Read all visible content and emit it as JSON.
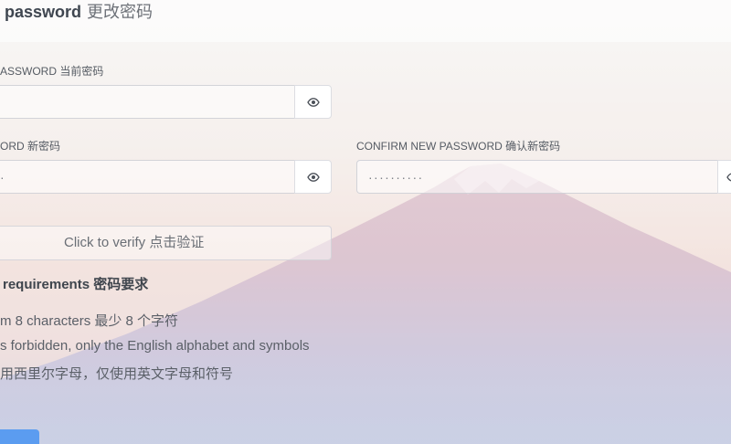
{
  "header": {
    "title_en": "password",
    "title_zh": "更改密码"
  },
  "form": {
    "current_password": {
      "label": "ASSWORD 当前密码",
      "value": "",
      "toggle_icon": "eye-icon"
    },
    "new_password": {
      "label": "ORD 新密码",
      "value": "·",
      "toggle_icon": "eye-icon"
    },
    "confirm_password": {
      "label": "CONFIRM NEW PASSWORD 确认新密码",
      "value": "··········",
      "toggle_icon": "eye-icon"
    },
    "verify_button": "Click to verify 点击验证"
  },
  "requirements": {
    "title": "requirements 密码要求",
    "items": [
      "m 8 characters 最少 8 个字符",
      "s forbidden, only the English alphabet and symbols",
      "用西里尔字母，仅使用英文字母和符号"
    ]
  },
  "colors": {
    "submit_button": "#5b9cf0",
    "icon": "#4b5058"
  }
}
